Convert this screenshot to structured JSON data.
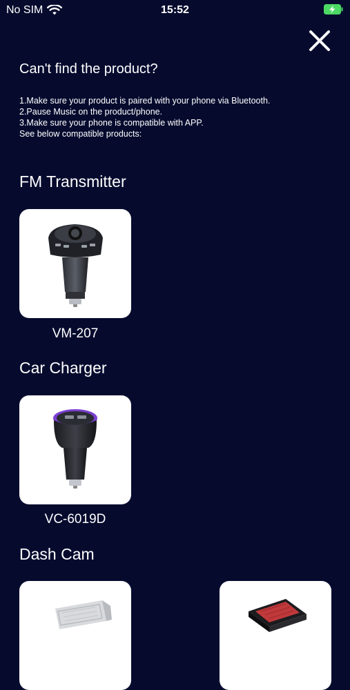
{
  "status": {
    "carrier": "No SIM",
    "time": "15:52",
    "icons": {
      "wifi": "wifi-icon",
      "battery": "battery-charging-icon"
    }
  },
  "header": {
    "title": "Can't find the product?",
    "close_icon": "close-icon"
  },
  "help": {
    "lines": [
      "1.Make sure your product is paired with your phone via Bluetooth.",
      "2.Pause Music on the product/phone.",
      "3.Make sure your phone is compatible with APP.",
      "See below compatible products:"
    ]
  },
  "sections": [
    {
      "title": "FM Transmitter",
      "products": [
        {
          "name": "VM-207",
          "image": "fm-transmitter-image"
        }
      ]
    },
    {
      "title": "Car Charger",
      "products": [
        {
          "name": "VC-6019D",
          "image": "car-charger-image"
        }
      ]
    },
    {
      "title": "Dash Cam",
      "products": [
        {
          "name": "",
          "image": "dash-cam-image"
        },
        {
          "name": "",
          "image": "dash-cam-image"
        }
      ]
    }
  ],
  "colors": {
    "background": "#060b2e",
    "text": "#ffffff",
    "card": "#ffffff",
    "battery": "#4cd964"
  }
}
